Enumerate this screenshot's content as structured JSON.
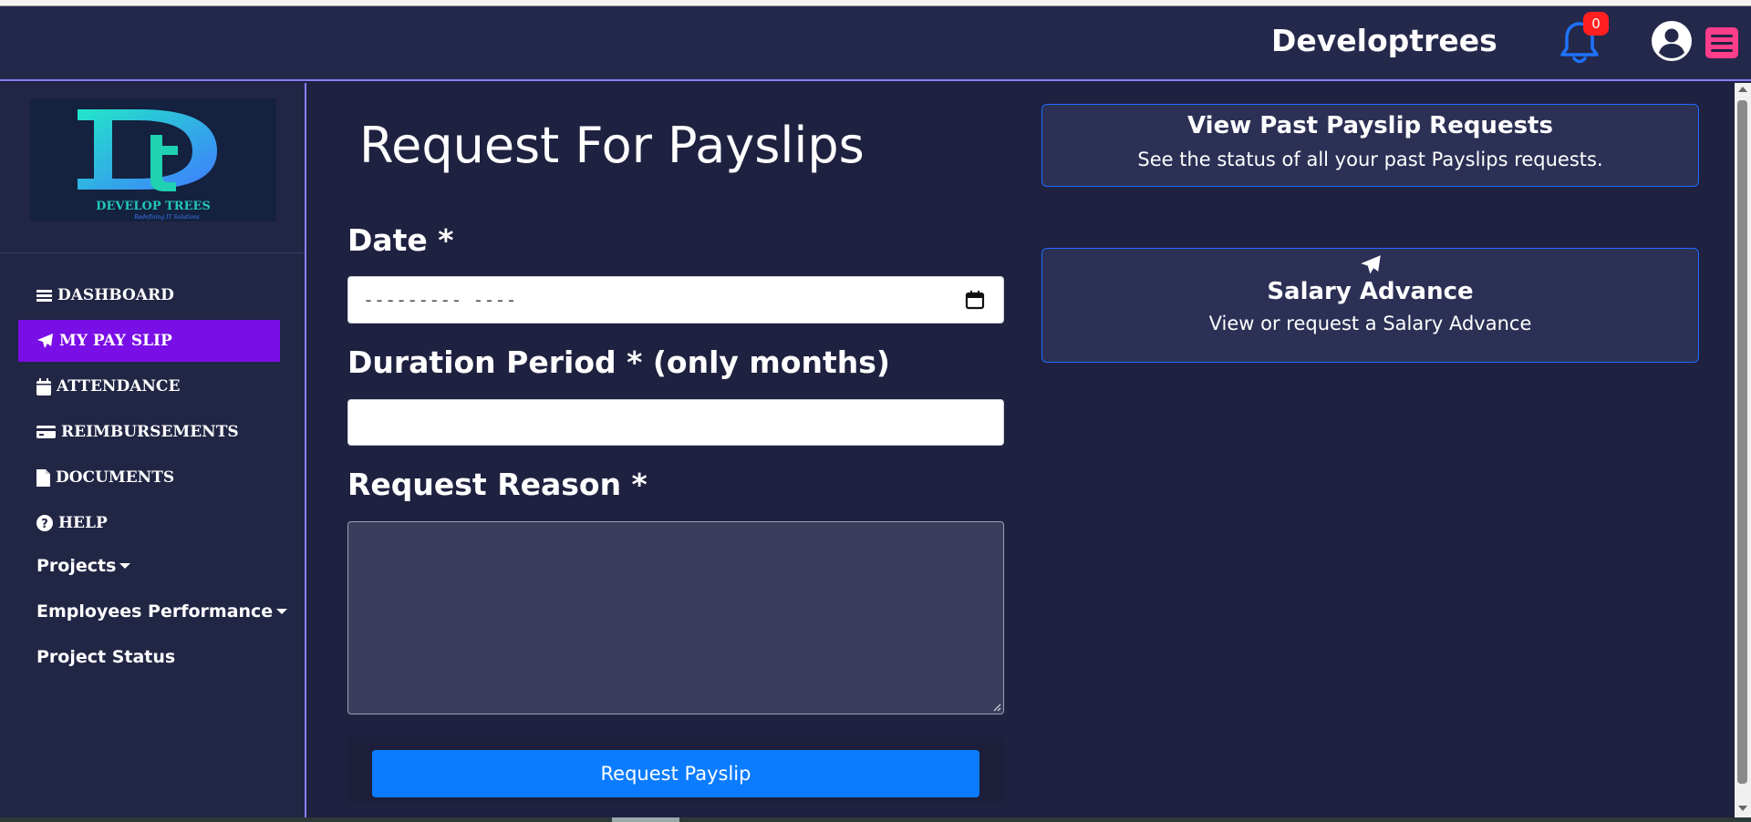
{
  "header": {
    "brand": "Developtrees",
    "notification_count": "0"
  },
  "logo": {
    "letters": "Dt",
    "name": "DEVELOP TREES",
    "tagline": "Redefining IT Solutions"
  },
  "sidebar": {
    "items": [
      {
        "label": "DASHBOARD",
        "icon": "bars-icon"
      },
      {
        "label": "MY PAY SLIP",
        "icon": "paper-plane-icon",
        "active": true
      },
      {
        "label": "ATTENDANCE",
        "icon": "calendar-icon"
      },
      {
        "label": "REIMBURSEMENTS",
        "icon": "credit-card-icon"
      },
      {
        "label": "DOCUMENTS",
        "icon": "file-icon"
      },
      {
        "label": "HELP",
        "icon": "question-circle-icon"
      }
    ],
    "links": [
      {
        "label": "Projects",
        "dropdown": true
      },
      {
        "label": "Employees Performance",
        "dropdown": true
      },
      {
        "label": "Project Status",
        "dropdown": false
      }
    ]
  },
  "form": {
    "title": "Request For Payslips",
    "date_label": "Date *",
    "date_placeholder": "--------- ----",
    "duration_label": "Duration Period * (only months)",
    "duration_value": "",
    "reason_label": "Request Reason *",
    "reason_value": "",
    "submit_label": "Request Payslip"
  },
  "cards": {
    "past_requests": {
      "title": "View Past Payslip Requests",
      "subtitle": "See the status of all your past Payslips requests."
    },
    "salary_advance": {
      "title": "Salary Advance",
      "subtitle": "View or request a Salary Advance",
      "icon": "paper-plane-icon"
    }
  },
  "colors": {
    "background": "#1f2140",
    "header": "#24284b",
    "accent_border": "#8b7cf6",
    "active_nav": "#7a0ee6",
    "primary_button": "#0b7cff",
    "badge": "#ff1f1f",
    "menu_button": "#ff3d8b"
  }
}
